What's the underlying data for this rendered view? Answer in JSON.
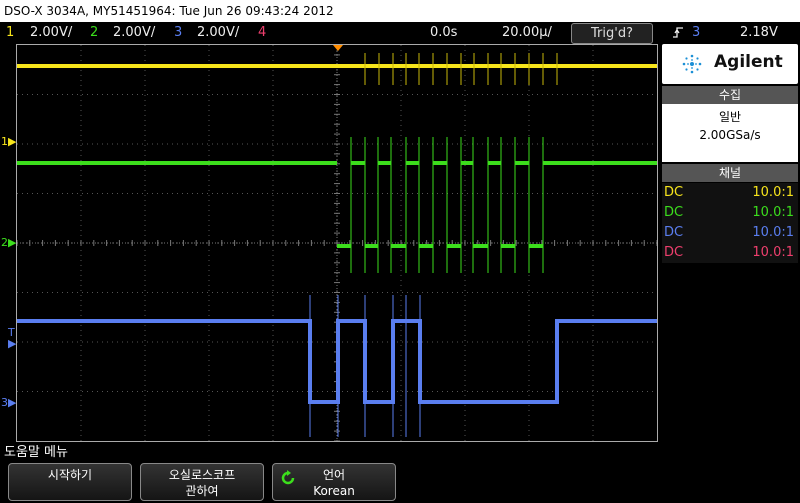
{
  "title_bar": {
    "text": "DSO-X 3034A, MY51451964: Tue Jun 26 09:43:24 2012"
  },
  "status_bar": {
    "channels": [
      {
        "num": "1",
        "scale": "2.00V/",
        "color": "#f7e51b"
      },
      {
        "num": "2",
        "scale": "2.00V/",
        "color": "#3cde1c"
      },
      {
        "num": "3",
        "scale": "2.00V/",
        "color": "#5a7ef0"
      },
      {
        "num": "4",
        "scale": "",
        "color": "#ef3f6e"
      }
    ],
    "delay": "0.0s",
    "timebase": "20.00µ/",
    "trigger_status": "Trig'd?",
    "trigger_source": "3",
    "trigger_level": "2.18V"
  },
  "ground_markers": {
    "ch1": "1",
    "ch2": "2",
    "ch3": "3",
    "trigger": "T"
  },
  "panel": {
    "brand": "Agilent",
    "acquire": {
      "header": "수집",
      "mode": "일반",
      "rate": "2.00GSa/s"
    },
    "channels": {
      "header": "채널",
      "rows": [
        {
          "coupling": "DC",
          "probe": "10.0:1",
          "color": "#f7e51b"
        },
        {
          "coupling": "DC",
          "probe": "10.0:1",
          "color": "#3cde1c"
        },
        {
          "coupling": "DC",
          "probe": "10.0:1",
          "color": "#5a7ef0"
        },
        {
          "coupling": "DC",
          "probe": "10.0:1",
          "color": "#ef3f6e"
        }
      ]
    }
  },
  "menu": {
    "title": "도움말 메뉴",
    "softkeys": [
      {
        "line1": "시작하기",
        "line2": ""
      },
      {
        "line1": "오실로스코프",
        "line2": "관하여"
      },
      {
        "line1": "언어",
        "line2": "Korean"
      }
    ]
  },
  "icons": {
    "trigger_edge": "rising-edge-icon",
    "language_cycle": "cycle-arrow-icon",
    "logo": "agilent-spark-icon"
  }
}
